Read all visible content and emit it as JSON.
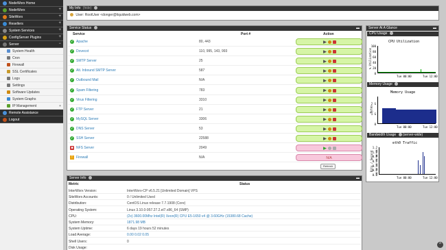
{
  "sidebar": {
    "items": [
      {
        "label": "NodeWorx Home",
        "color": "#4a90d9",
        "expandable": false
      },
      {
        "label": "NodeWorx",
        "color": "#5aa02c",
        "expandable": true
      },
      {
        "label": "SiteWorx",
        "color": "#e07b1a",
        "expandable": true
      },
      {
        "label": "Resellers",
        "color": "#3a8ad4",
        "expandable": true
      },
      {
        "label": "System Services",
        "color": "#8a8a8a",
        "expandable": true
      },
      {
        "label": "ConfigServer Plugins",
        "color": "#d4a017",
        "expandable": true
      },
      {
        "label": "Server",
        "color": "#777777",
        "expandable": true
      }
    ],
    "server_sub": [
      {
        "label": "System Health",
        "color": "#5a8fd0"
      },
      {
        "label": "Cron",
        "color": "#777777"
      },
      {
        "label": "Firewall",
        "color": "#c0501a"
      },
      {
        "label": "SSL Certificates",
        "color": "#c89a2c"
      },
      {
        "label": "Logs",
        "color": "#777777"
      },
      {
        "label": "Settings",
        "color": "#777777"
      },
      {
        "label": "Software Updates",
        "color": "#d08a10"
      },
      {
        "label": "System Graphs",
        "color": "#3a8ad4"
      },
      {
        "label": "IP Management",
        "color": "#5aa02c"
      }
    ],
    "bottom": [
      {
        "label": "Remote Assistance",
        "color": "#4a90d9"
      },
      {
        "label": "Logout",
        "color": "#c0501a"
      }
    ]
  },
  "myinfo": {
    "title": "My Info",
    "toggle": "(hide)",
    "user": "User: RootUser <donger@liquidweb.com>"
  },
  "service_status": {
    "title": "Service Status",
    "col_service": "Service",
    "col_port": "Port #",
    "col_action": "Action",
    "refresh_label": "Refresh",
    "rows": [
      {
        "name": "Apache",
        "port": "80, 443",
        "status": "ok"
      },
      {
        "name": "Dovecot",
        "port": "110, 995, 143, 993",
        "status": "ok"
      },
      {
        "name": "SMTP Server",
        "port": "25",
        "status": "ok"
      },
      {
        "name": "Alt. Inbound SMTP Server",
        "port": "587",
        "status": "ok"
      },
      {
        "name": "Outbound Mail",
        "port": "N/A",
        "status": "ok"
      },
      {
        "name": "Spam Filtering",
        "port": "783",
        "status": "ok"
      },
      {
        "name": "Virus Filtering",
        "port": "3310",
        "status": "ok"
      },
      {
        "name": "FTP Server",
        "port": "21",
        "status": "ok"
      },
      {
        "name": "MySQL Server",
        "port": "3306",
        "status": "ok"
      },
      {
        "name": "DNS Server",
        "port": "53",
        "status": "ok"
      },
      {
        "name": "SSH Server",
        "port": "22588",
        "status": "ok"
      },
      {
        "name": "NFS Server",
        "port": "2049",
        "status": "stopped"
      },
      {
        "name": "Firewall",
        "port": "N/A",
        "status": "warn",
        "action_text": "N/A"
      }
    ]
  },
  "server_info": {
    "title": "Server Info",
    "col_metric": "Metric",
    "col_status": "Status",
    "rows": [
      {
        "metric": "InterWorx Version:",
        "status": "InterWorx-CP v6.5.21 [Unlimited Domain] VPS",
        "link": false
      },
      {
        "metric": "SiteWorx Accounts:",
        "status": "0 / Unlimited Used",
        "link": false
      },
      {
        "metric": "Distribution:",
        "status": "CentOS Linux release 7.7.1908 (Core)",
        "link": false
      },
      {
        "metric": "Operating System:",
        "status": "Linux 3.10.0-957.27.2.el7.x86_64 (SMP)",
        "link": false
      },
      {
        "metric": "CPU:",
        "status": "(2x) 3600.00Mhz Intel(R) Xeon(R) CPU E5-1650 v4 @ 3.60GHz (15380.68 Cache)",
        "link": true
      },
      {
        "metric": "System Memory:",
        "status": "1871.98 MB",
        "link": true
      },
      {
        "metric": "System Uptime:",
        "status": "6 days 19 hours 52 minutes",
        "link": false
      },
      {
        "metric": "Load Average:",
        "status": "0.00 0.02 0.05",
        "link": true
      },
      {
        "metric": "Shell Users:",
        "status": "0",
        "link": false
      },
      {
        "metric": "Disk Usage:",
        "status": "",
        "link": false
      }
    ]
  },
  "glance": {
    "title": "Server At A Glance",
    "cpu": {
      "header": "CPU Usage",
      "chart_title": "CPU Utilization",
      "ylabel": "% Utilization",
      "yticks": [
        "100",
        "80",
        "60",
        "40",
        "20",
        "0"
      ],
      "xticks": [
        "Tue 00:00",
        "Tue 12:00"
      ]
    },
    "memory": {
      "header": "Memory Usage",
      "chart_title": "Memory Usage",
      "ylabel": "Bytes",
      "yticks": [
        "2 G",
        "1 G",
        "0"
      ],
      "xticks": [
        "Tue 00:00",
        "Tue 12:00"
      ]
    },
    "bandwidth": {
      "header": "Bandwidth Usage",
      "header_suffix": "(server-wide)",
      "chart_title": "eth0 Traffic",
      "ylabel": "Bits / Second",
      "yticks": [
        "1.2 M",
        "1.0 M",
        "0.8 M",
        "0.6 M",
        "0.4 M",
        "0.2 M",
        "0.0"
      ],
      "xticks": [
        "Tue 00:00",
        "Tue 12:00"
      ]
    }
  },
  "colors": {
    "ok_action_bg": "#d6f5a6",
    "stopped_action_bg": "#f8c8dc",
    "ok_icon": "#33aa33",
    "stopped_icon": "#cc3333",
    "header_bg": "#333333",
    "link": "#2a7ab5",
    "chart_fill": "#1c2d8c"
  }
}
